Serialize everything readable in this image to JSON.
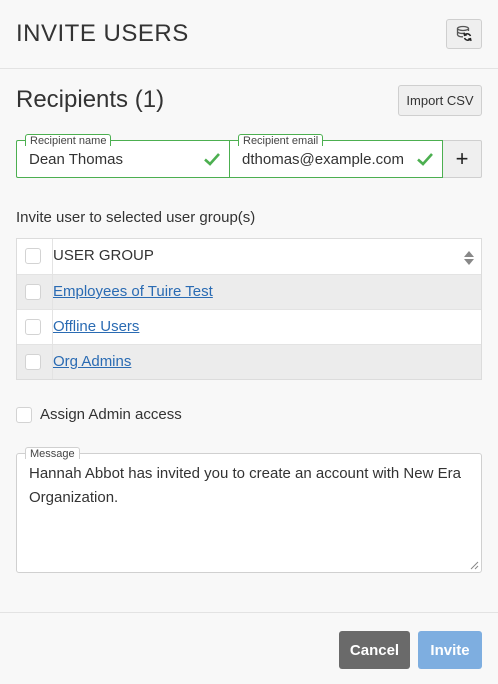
{
  "header": {
    "title": "INVITE USERS",
    "refresh_icon": "database-refresh-icon"
  },
  "recipients": {
    "title": "Recipients (1)",
    "import_label": "Import CSV"
  },
  "fields": {
    "name_label": "Recipient name",
    "name_value": "Dean Thomas",
    "email_label": "Recipient email",
    "email_value": "dthomas@example.com",
    "check_icon": "check-icon",
    "valid_color": "#4caf50",
    "add_label": "+"
  },
  "groups": {
    "intro": "Invite user to selected user group(s)",
    "column_header": "USER GROUP",
    "rows": [
      {
        "name": "Employees of Tuire Test"
      },
      {
        "name": "Offline Users"
      },
      {
        "name": "Org Admins"
      }
    ]
  },
  "admin": {
    "label": "Assign Admin access"
  },
  "message": {
    "label": "Message",
    "text": "Hannah Abbot has invited you to create an account with New Era Organization."
  },
  "footer": {
    "cancel_label": "Cancel",
    "invite_label": "Invite"
  },
  "colors": {
    "link": "#2a6bb3",
    "cancel_bg": "#6a6a6a",
    "invite_bg": "#7eaee0"
  }
}
